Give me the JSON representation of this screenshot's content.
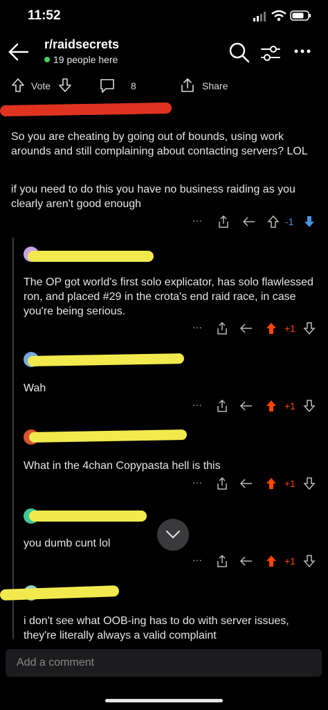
{
  "status": {
    "time": "11:52"
  },
  "header": {
    "title": "r/raidsecrets",
    "online": "19 people here"
  },
  "actions": {
    "vote_label": "Vote",
    "comments_count": "8",
    "share_label": "Share"
  },
  "comments": [
    {
      "text1": "So you are cheating by going out of bounds, using work arounds and still complaining about contacting servers? LOL",
      "text2": "if you need to do this you have no business raiding as you clearly aren't good enough",
      "score": "-1"
    },
    {
      "text": "The OP got world's first solo explicator, has solo flawlessed ron, and placed #29 in the crota's end raid race, in case you're being serious.",
      "score": "+1"
    },
    {
      "text": "Wah",
      "score": "+1"
    },
    {
      "text": "What in the 4chan Copypasta hell is this",
      "score": "+1"
    },
    {
      "text": "you dumb cunt lol",
      "score": "+1"
    },
    {
      "text": "i don't see what OOB-ing has to do with server issues, they're literally always a valid complaint"
    }
  ],
  "composer": {
    "placeholder": "Add a comment"
  },
  "colors": {
    "upvote": "#ff4500",
    "downvote": "#4a90e2",
    "online": "#46d160"
  }
}
